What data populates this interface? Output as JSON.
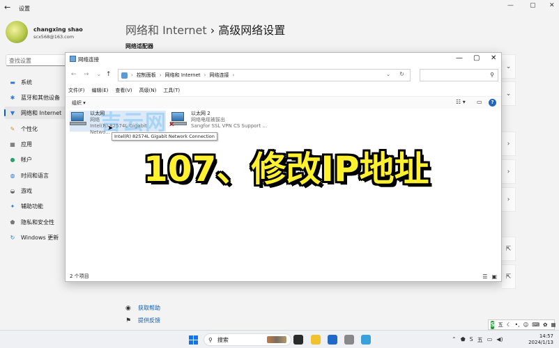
{
  "settings": {
    "title": "设置",
    "user": {
      "name": "changxing shao",
      "email": "scx568@163.com"
    },
    "search_placeholder": "查找设置",
    "nav": [
      {
        "label": "系统",
        "icon": "monitor-icon"
      },
      {
        "label": "蓝牙和其他设备",
        "icon": "bluetooth-icon"
      },
      {
        "label": "网络和 Internet",
        "icon": "wifi-icon",
        "active": true
      },
      {
        "label": "个性化",
        "icon": "brush-icon"
      },
      {
        "label": "应用",
        "icon": "apps-icon"
      },
      {
        "label": "帐户",
        "icon": "person-icon"
      },
      {
        "label": "时间和语言",
        "icon": "globe-clock-icon"
      },
      {
        "label": "游戏",
        "icon": "gamepad-icon"
      },
      {
        "label": "辅助功能",
        "icon": "accessibility-icon"
      },
      {
        "label": "隐私和安全性",
        "icon": "shield-icon"
      },
      {
        "label": "Windows 更新",
        "icon": "update-icon"
      }
    ],
    "breadcrumb": {
      "parent": "网络和 Internet",
      "sep": "›",
      "current": "高级网络设置"
    },
    "subheading": "网络适配器",
    "bottom_links": {
      "help": "获取帮助",
      "feedback": "提供反馈"
    }
  },
  "explorer": {
    "title": "网络连接",
    "breadcrumb": [
      "控制面板",
      "网络和 Internet",
      "网络连接"
    ],
    "menu": [
      "文件(F)",
      "编辑(E)",
      "查看(V)",
      "高级(N)",
      "工具(T)"
    ],
    "organize": "组织 ▾",
    "items": [
      {
        "name": "以太网",
        "status": "网络",
        "device": "Intel(R) 82574L Gigabit Netwo..."
      },
      {
        "name": "以太网 2",
        "status": "网络电缆被拔出",
        "device": "Sangfor SSL VPN CS Support ..."
      }
    ],
    "tooltip": "Intel(R) 82574L Gigabit Network Connection",
    "status_bar": "2 个项目"
  },
  "overlay": {
    "watermark": "吉云网",
    "caption": "107、修改IP地址"
  },
  "taskbar": {
    "search_label": "搜索",
    "time": "14:57",
    "date": "2024/1/13",
    "ime": "五"
  }
}
